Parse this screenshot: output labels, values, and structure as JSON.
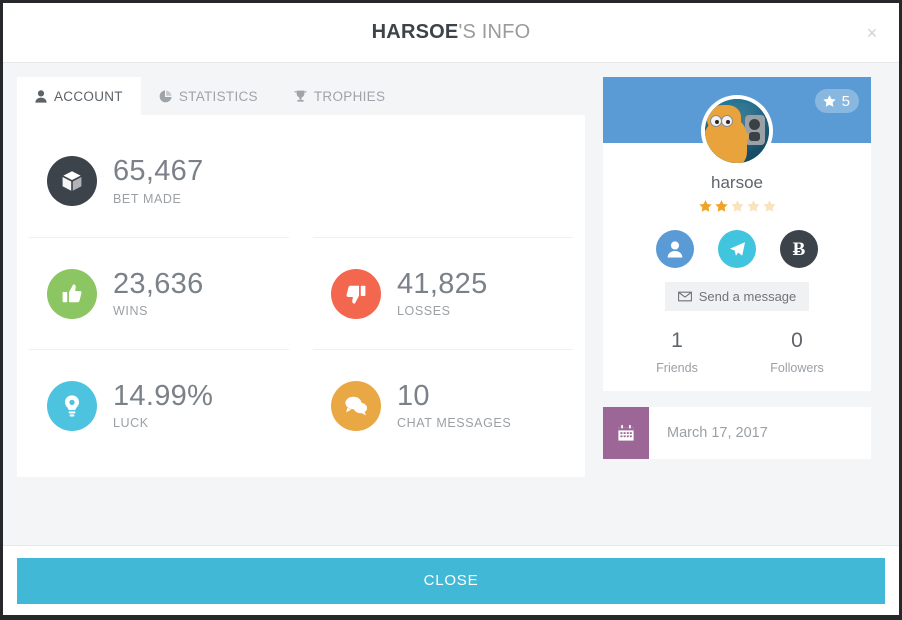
{
  "header": {
    "title_strong": "HARSOE",
    "title_rest": "'S INFO",
    "close_icon": "×"
  },
  "tabs": [
    {
      "label": "ACCOUNT",
      "icon": "user-icon",
      "active": true
    },
    {
      "label": "STATISTICS",
      "icon": "pie-chart-icon",
      "active": false
    },
    {
      "label": "TROPHIES",
      "icon": "trophy-icon",
      "active": false
    }
  ],
  "stats": [
    {
      "value": "65,467",
      "label": "BET MADE",
      "icon": "cube-icon",
      "color": "#3c434a"
    },
    {
      "value": "23,636",
      "label": "WINS",
      "icon": "thumbs-up-icon",
      "color": "#8cc663"
    },
    {
      "value": "41,825",
      "label": "LOSSES",
      "icon": "thumbs-down-icon",
      "color": "#f4674f"
    },
    {
      "value": "14.99%",
      "label": "LUCK",
      "icon": "lightbulb-icon",
      "color": "#4ec3e0"
    },
    {
      "value": "10",
      "label": "CHAT MESSAGES",
      "icon": "chat-bubbles-icon",
      "color": "#eaa844"
    }
  ],
  "profile": {
    "username": "harsoe",
    "level": "5",
    "level_icon": "star-icon",
    "stars_filled": 2,
    "stars_total": 5,
    "cover_color": "#5b9bd5",
    "avatar_name": "user-avatar",
    "social": [
      {
        "name": "add-friend-button",
        "icon": "user-icon",
        "color": "#5b9bd5"
      },
      {
        "name": "tip-button",
        "icon": "paper-plane-icon",
        "color": "#41c4dd"
      },
      {
        "name": "bitcoin-button",
        "icon": "bitcoin-icon",
        "color": "#3c434a",
        "glyph": "Ƀ"
      }
    ],
    "message_button": {
      "label": "Send a message",
      "icon": "envelope-icon"
    },
    "counts": [
      {
        "num": "1",
        "caption": "Friends"
      },
      {
        "num": "0",
        "caption": "Followers"
      }
    ]
  },
  "date_card": {
    "icon": "calendar-icon",
    "date": "March 17, 2017",
    "icon_color": "#9c6796"
  },
  "footer": {
    "close_label": "CLOSE",
    "close_color": "#41b9d6"
  }
}
